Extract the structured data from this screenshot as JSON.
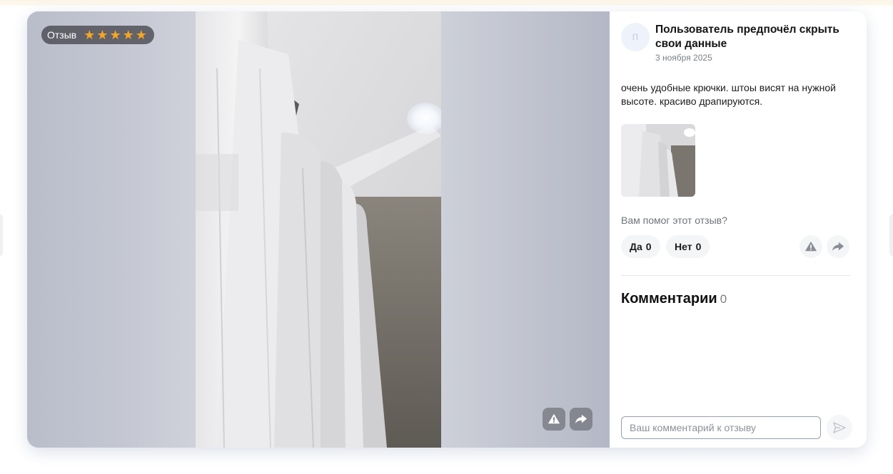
{
  "review": {
    "badge_label": "Отзыв",
    "rating": 5,
    "stars": [
      "★",
      "★",
      "★",
      "★",
      "★"
    ],
    "author": "Пользователь предпочёл скрыть свои данные",
    "avatar_letter": "п",
    "date": "3 ноября 2025",
    "text": "очень удобные крючки. штоы висят на нужной высоте. красиво драпируются."
  },
  "helpful": {
    "question": "Вам помог этот отзыв?",
    "yes_label": "Да",
    "yes_count": "0",
    "no_label": "Нет",
    "no_count": "0"
  },
  "comments": {
    "title": "Комментарии",
    "count": "0",
    "input_placeholder": "Ваш комментарий к отзыву"
  },
  "icons": {
    "star": "star-icon",
    "report": "warning-triangle-icon",
    "share": "share-arrow-icon",
    "send": "send-icon"
  },
  "colors": {
    "star": "#f6a623",
    "badge_bg": "#3c3c42",
    "muted_text": "#7b7f87"
  }
}
